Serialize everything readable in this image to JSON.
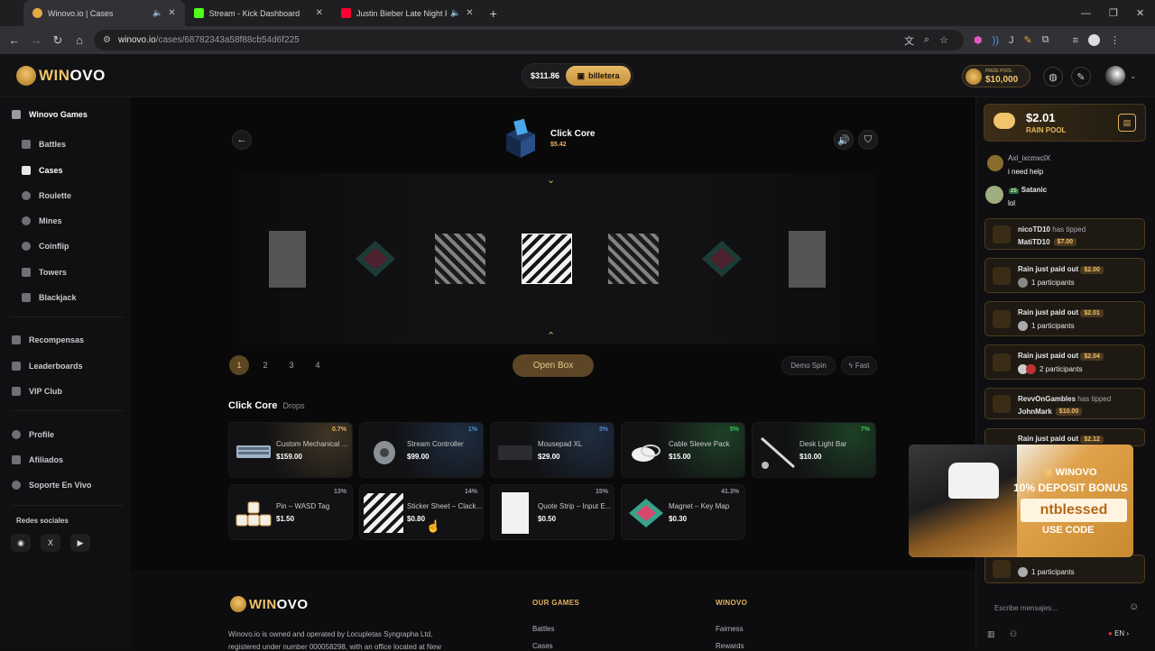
{
  "browser": {
    "tabs": [
      {
        "title": "Winovo.io | Cases",
        "active": true,
        "favicon_color": "#e3a944"
      },
      {
        "title": "Stream - Kick Dashboard",
        "active": false,
        "favicon_color": "#53fc18"
      },
      {
        "title": "Justin Bieber Late Night Pla",
        "active": false,
        "favicon_color": "#ff0033"
      }
    ],
    "url_host": "winovo.io",
    "url_path": "/cases/68782343a58f88cb54d6f225"
  },
  "header": {
    "logo_win": "WIN",
    "logo_ovo": "OVO",
    "balance": "$311.86",
    "wallet_label": "billetera",
    "prize_pool_label": "PRIZE POOL",
    "prize_pool_amount": "$10,000"
  },
  "sidebar": {
    "section_title": "Winovo Games",
    "games": [
      "Battles",
      "Cases",
      "Roulette",
      "Mines",
      "Coinflip",
      "Towers",
      "Blackjack"
    ],
    "active_game": "Cases",
    "extras": [
      "Recompensas",
      "Leaderboards",
      "VIP Club"
    ],
    "account": [
      "Profile",
      "Afiliados",
      "Soporte En Vivo"
    ],
    "social_title": "Redes sociales",
    "social": [
      "discord-icon",
      "x-icon",
      "youtube-icon"
    ]
  },
  "case": {
    "name": "Click Core",
    "price": "$5.42",
    "pages": [
      "1",
      "2",
      "3",
      "4"
    ],
    "active_page": "1",
    "open_label": "Open Box",
    "demo_label": "Demo Spin",
    "fast_label": "Fast",
    "drops_title": "Click Core",
    "drops_subtitle": "Drops"
  },
  "drops": [
    {
      "name": "Custom Mechanical ...",
      "price": "$159.00",
      "pct": "0.7%",
      "color": "#e2b35e"
    },
    {
      "name": "Stream Controller",
      "price": "$99.00",
      "pct": "1%",
      "color": "#4a8fe0"
    },
    {
      "name": "Mousepad XL",
      "price": "$29.00",
      "pct": "3%",
      "color": "#4a8fe0"
    },
    {
      "name": "Cable Sleeve Pack",
      "price": "$15.00",
      "pct": "5%",
      "color": "#3ec95a"
    },
    {
      "name": "Desk Light Bar",
      "price": "$10.00",
      "pct": "7%",
      "color": "#3ec95a"
    },
    {
      "name": "Pin – WASD Tag",
      "price": "$1.50",
      "pct": "13%",
      "color": "#9a9aa0"
    },
    {
      "name": "Sticker Sheet – Clack...",
      "price": "$0.80",
      "pct": "14%",
      "color": "#9a9aa0"
    },
    {
      "name": "Quote Strip – Input E...",
      "price": "$0.50",
      "pct": "15%",
      "color": "#9a9aa0"
    },
    {
      "name": "Magnet – Key Map",
      "price": "$0.30",
      "pct": "41.3%",
      "color": "#9a9aa0"
    }
  ],
  "footer": {
    "logo_win": "WIN",
    "logo_ovo": "OVO",
    "text1": "Winovo.io is owned and operated by Locupletas Syngrapha Ltd,",
    "text2": "registered under number 000058298, with an office located at New",
    "col1_title": "OUR GAMES",
    "col1_links": [
      "Battles",
      "Cases"
    ],
    "col2_title": "WINOVO",
    "col2_links": [
      "Fairness",
      "Rewards"
    ]
  },
  "chat": {
    "rain_amount": "$2.01",
    "rain_label": "RAIN POOL",
    "messages": [
      {
        "user": "Axl_ixcmxclX",
        "text": "i need help"
      },
      {
        "user": "Satanic",
        "text": "lol"
      }
    ],
    "tip1": {
      "from": "nicoTD10",
      "verb": "has tipped",
      "to": "MatiTD10",
      "amount": "$7.00"
    },
    "rains": [
      {
        "text": "Rain just paid out",
        "amount": "$2.00",
        "participants": "1 participants"
      },
      {
        "text": "Rain just paid out",
        "amount": "$2.01",
        "participants": "1 participants"
      },
      {
        "text": "Rain just paid out",
        "amount": "$2.04",
        "participants": "2 participants"
      }
    ],
    "tip2": {
      "from": "RevvOnGambles",
      "verb": "has tipped",
      "to": "JohnMark",
      "amount": "$10.00"
    },
    "rain4": {
      "text": "Rain just paid out",
      "amount": "$2.12"
    },
    "last_participants": "1 participants",
    "input_placeholder": "Escribe mensajes...",
    "lang": "EN"
  },
  "promo": {
    "brand": "WINOVO",
    "headline": "10% DEPOSIT BONUS",
    "code": "ntblessed",
    "use_code": "USE CODE"
  }
}
